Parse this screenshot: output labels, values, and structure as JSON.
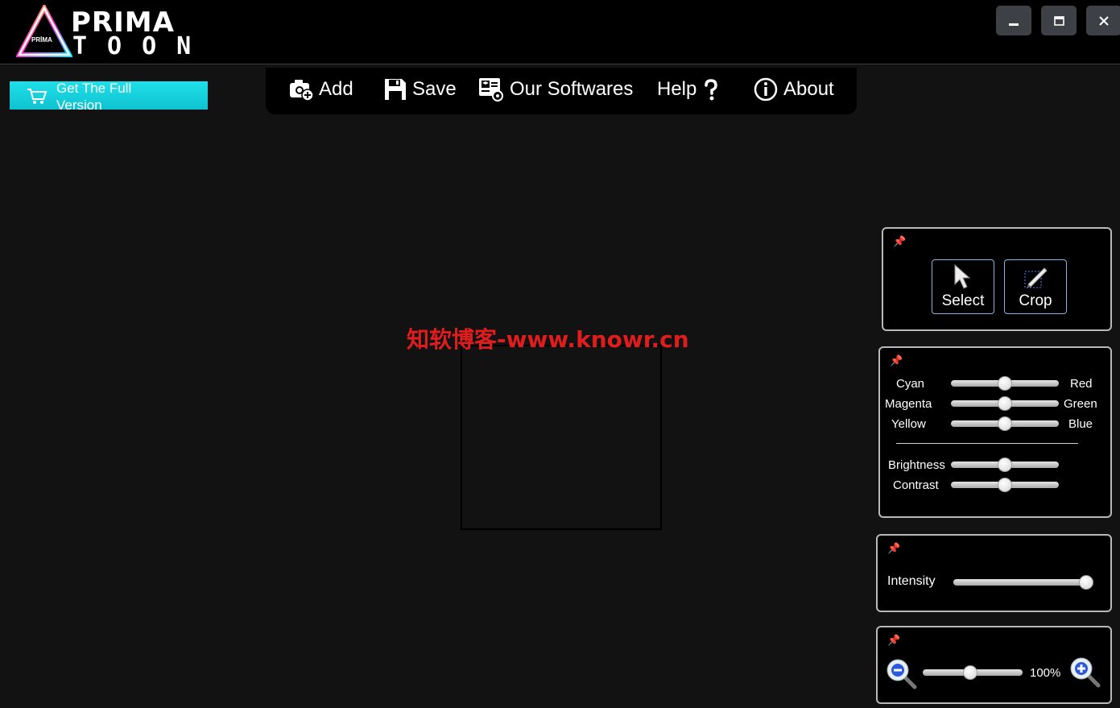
{
  "app": {
    "logo_prima": "PRIMA",
    "logo_toon": "TOON",
    "logo_small": "PRİMA"
  },
  "window": {
    "minimize_icon": "minimize-icon",
    "maximize_icon": "maximize-icon",
    "close_icon": "close-icon"
  },
  "promo": {
    "label": "Get The Full Version",
    "icon": "cart-icon"
  },
  "toolbar": {
    "add_label": "Add",
    "save_label": "Save",
    "softwares_label": "Our Softwares",
    "help_label": "Help",
    "about_label": "About"
  },
  "watermark": "知软博客-www.knowr.cn",
  "tools": {
    "select_label": "Select",
    "crop_label": "Crop"
  },
  "color_balance": {
    "rows": [
      {
        "left": "Cyan",
        "right": "Red",
        "value": 0.5
      },
      {
        "left": "Magenta",
        "right": "Green",
        "value": 0.5
      },
      {
        "left": "Yellow",
        "right": "Blue",
        "value": 0.5
      }
    ],
    "brightness_label": "Brightness",
    "brightness_value": 0.5,
    "contrast_label": "Contrast",
    "contrast_value": 0.5
  },
  "intensity": {
    "label": "Intensity",
    "value": 1.0
  },
  "zoom": {
    "value_text": "100%",
    "slider_value": 0.5
  }
}
